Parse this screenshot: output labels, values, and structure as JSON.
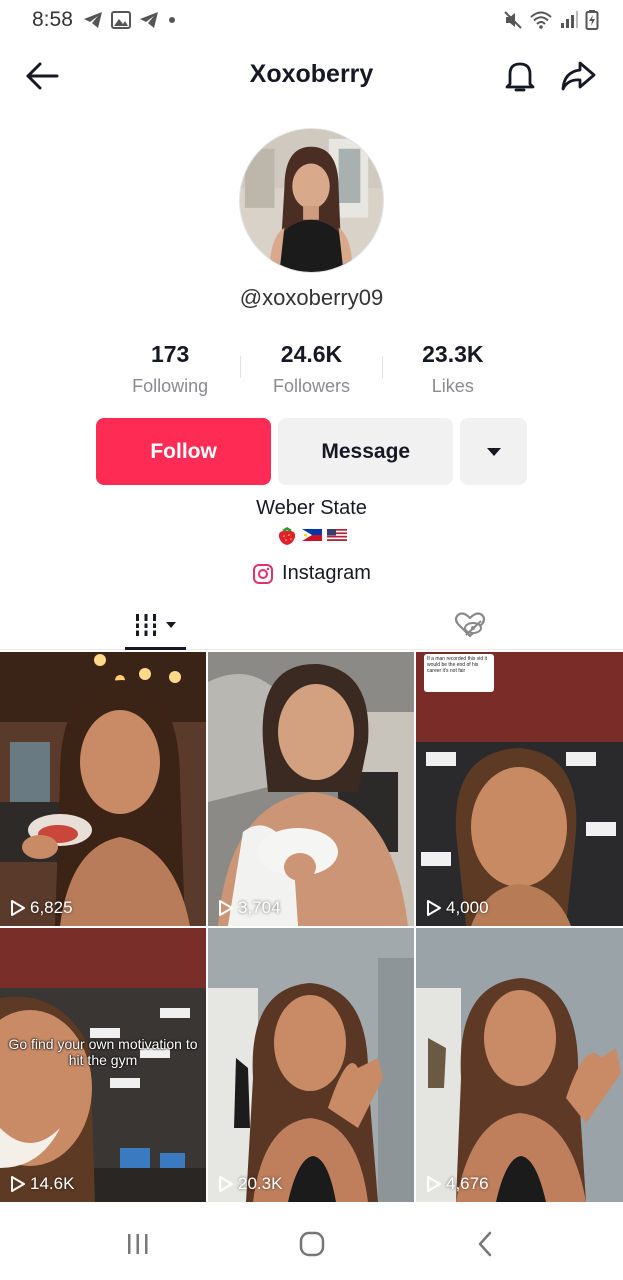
{
  "status_bar": {
    "time": "8:58",
    "icons_left": [
      "telegram-icon",
      "gallery-icon",
      "telegram-icon",
      "dot-icon"
    ],
    "icons_right": [
      "mute-icon",
      "wifi-icon",
      "signal-icon",
      "battery-icon"
    ]
  },
  "header": {
    "title": "Xoxoberry",
    "back_icon": "arrow-left-icon",
    "bell_icon": "bell-icon",
    "share_icon": "share-arrow-icon"
  },
  "profile": {
    "username": "@xoxoberry09",
    "stats": [
      {
        "value": "173",
        "label": "Following"
      },
      {
        "value": "24.6K",
        "label": "Followers"
      },
      {
        "value": "23.3K",
        "label": "Likes"
      }
    ],
    "follow_label": "Follow",
    "message_label": "Message",
    "more_icon": "caret-down-icon",
    "bio": "Weber State",
    "bio_emojis": [
      "strawberry-icon",
      "philippines-flag-icon",
      "us-flag-icon"
    ],
    "link_label": "Instagram",
    "link_icon": "instagram-icon"
  },
  "tabs": {
    "videos_icon": "grid-bars-icon",
    "liked_icon": "hidden-heart-icon"
  },
  "videos": [
    {
      "views": "6,825"
    },
    {
      "views": "3,704"
    },
    {
      "views": "4,000",
      "note_text": "If a man recorded this vid it would be the end of his career it's not fair"
    },
    {
      "views": "14.6K",
      "caption": "Go find your own motivation to hit the gym"
    },
    {
      "views": "20.3K"
    },
    {
      "views": "4,676"
    }
  ],
  "colors": {
    "accent": "#fe2c55",
    "secondary_button": "#f1f1f2",
    "text_primary": "#161823",
    "text_secondary": "#8a8b91"
  },
  "navbar": {
    "icons": [
      "recent-apps-icon",
      "home-icon",
      "back-icon"
    ]
  }
}
